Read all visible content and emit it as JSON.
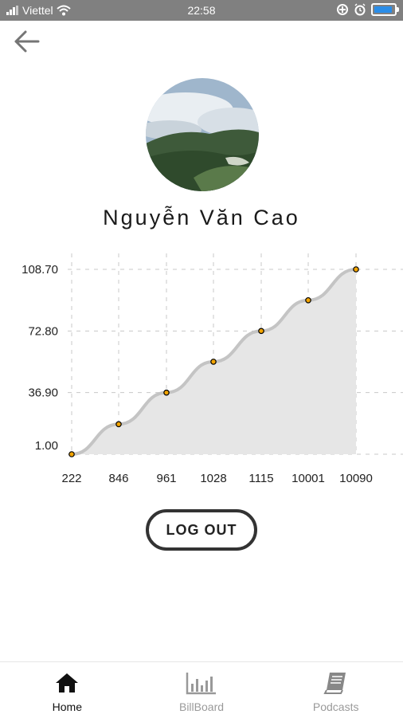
{
  "status_bar": {
    "carrier": "Viettel",
    "time": "22:58",
    "battery_level": 0.9,
    "battery_color": "#2a8de8"
  },
  "header": {
    "back_icon": "arrow-left-icon"
  },
  "profile": {
    "name": "Nguyễn Văn Cao",
    "avatar_icon": "landscape-avatar"
  },
  "chart_data": {
    "type": "area",
    "categories": [
      "222",
      "846",
      "961",
      "1028",
      "1115",
      "10001",
      "10090"
    ],
    "values": [
      1.0,
      18.5,
      36.9,
      54.9,
      72.8,
      90.7,
      108.7
    ],
    "y_ticks": [
      "1.00",
      "36.90",
      "72.80",
      "108.70"
    ],
    "y_tick_values": [
      1.0,
      36.9,
      72.8,
      108.7
    ],
    "ylim": [
      1.0,
      108.7
    ],
    "grid": true,
    "line_color": "#c4c4c4",
    "fill_color": "#e6e6e6",
    "point_color": "#f2a400"
  },
  "actions": {
    "logout_label": "LOG OUT"
  },
  "bottom_nav": {
    "items": [
      {
        "label": "Home",
        "icon": "home-icon",
        "active": true
      },
      {
        "label": "BillBoard",
        "icon": "bar-chart-icon",
        "active": false
      },
      {
        "label": "Podcasts",
        "icon": "book-icon",
        "active": false
      }
    ]
  }
}
